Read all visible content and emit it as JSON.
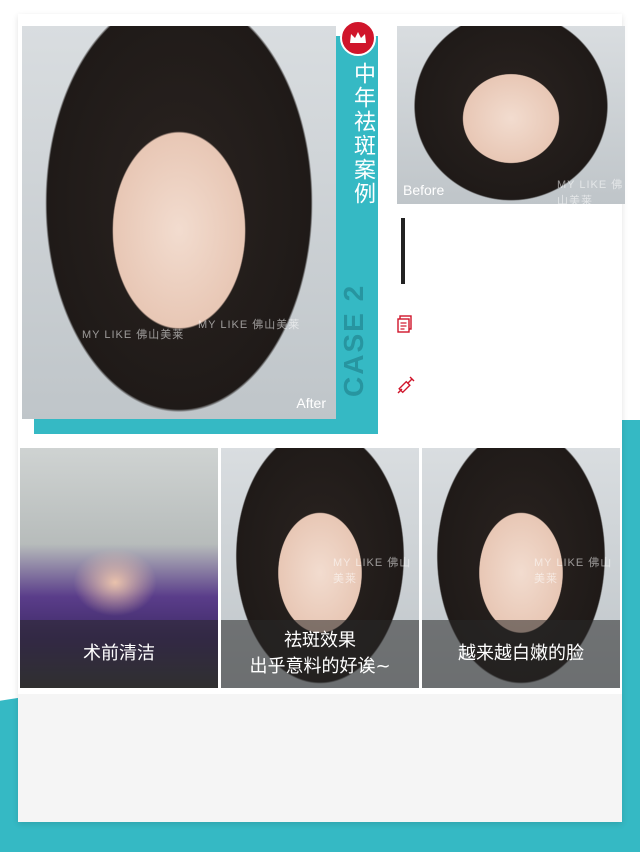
{
  "hero": {
    "after_label": "After",
    "before_label": "Before",
    "watermark": "MY LIKE 佛山美莱"
  },
  "ribbon": {
    "title": "中年祛斑案例",
    "case_label": "CASE 2"
  },
  "icons": [
    "crown-icon",
    "document-icon",
    "syringe-icon"
  ],
  "thumbnails": [
    {
      "caption_1": "术前清洁",
      "caption_2": ""
    },
    {
      "caption_1": "祛斑效果",
      "caption_2": "出乎意料的好诶~"
    },
    {
      "caption_1": "越来越白嫩的脸",
      "caption_2": ""
    }
  ],
  "colors": {
    "accent": "#35b9c4",
    "brand_red": "#d0152b"
  }
}
